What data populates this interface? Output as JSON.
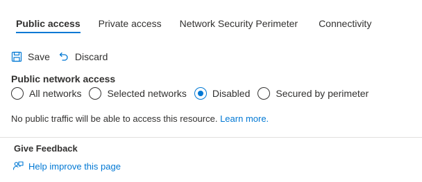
{
  "tabs": [
    {
      "label": "Public access",
      "active": true
    },
    {
      "label": "Private access",
      "active": false
    },
    {
      "label": "Network Security Perimeter",
      "active": false
    },
    {
      "label": "Connectivity",
      "active": false
    }
  ],
  "toolbar": {
    "save_label": "Save",
    "save_icon": "save-icon",
    "discard_label": "Discard",
    "discard_icon": "undo-icon"
  },
  "public_network_access": {
    "label": "Public network access",
    "options": [
      {
        "label": "All networks",
        "checked": false
      },
      {
        "label": "Selected networks",
        "checked": false
      },
      {
        "label": "Disabled",
        "checked": true
      },
      {
        "label": "Secured by perimeter",
        "checked": false
      }
    ]
  },
  "info": {
    "text": "No public traffic will be able to access this resource.",
    "link": "Learn more."
  },
  "feedback": {
    "title": "Give Feedback",
    "link": "Help improve this page",
    "icon": "feedback-icon"
  },
  "colors": {
    "accent": "#0078d4",
    "text": "#323130",
    "divider": "#e1dfdd"
  }
}
